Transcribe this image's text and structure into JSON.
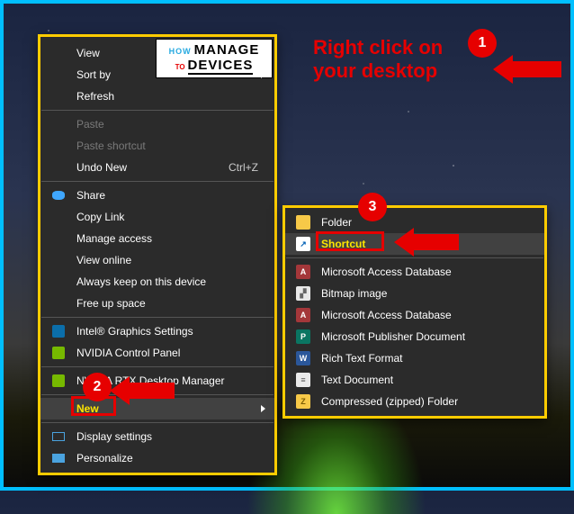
{
  "annotations": {
    "step1_label": "1",
    "step2_label": "2",
    "step3_label": "3",
    "instruction_line1": "Right click on",
    "instruction_line2": "your desktop"
  },
  "logo": {
    "how": "HOW",
    "to": "TO",
    "manage": "MANAGE",
    "devices": "DEVICES"
  },
  "context_menu": {
    "view": "View",
    "sort_by": "Sort by",
    "refresh": "Refresh",
    "paste": "Paste",
    "paste_shortcut": "Paste shortcut",
    "undo_new": "Undo New",
    "undo_shortcut": "Ctrl+Z",
    "share": "Share",
    "copy_link": "Copy Link",
    "manage_access": "Manage access",
    "view_online": "View online",
    "always_keep": "Always keep on this device",
    "free_up": "Free up space",
    "intel_graphics": "Intel® Graphics Settings",
    "nvidia_cp": "NVIDIA Control Panel",
    "nvidia_rtx": "NVIDIA RTX Desktop Manager",
    "new": "New",
    "display_settings": "Display settings",
    "personalize": "Personalize"
  },
  "new_submenu": {
    "folder": "Folder",
    "shortcut": "Shortcut",
    "access_db1": "Microsoft Access Database",
    "bitmap": "Bitmap image",
    "access_db2": "Microsoft Access Database",
    "publisher": "Microsoft Publisher Document",
    "rtf": "Rich Text Format",
    "txt": "Text Document",
    "zip": "Compressed (zipped) Folder"
  }
}
